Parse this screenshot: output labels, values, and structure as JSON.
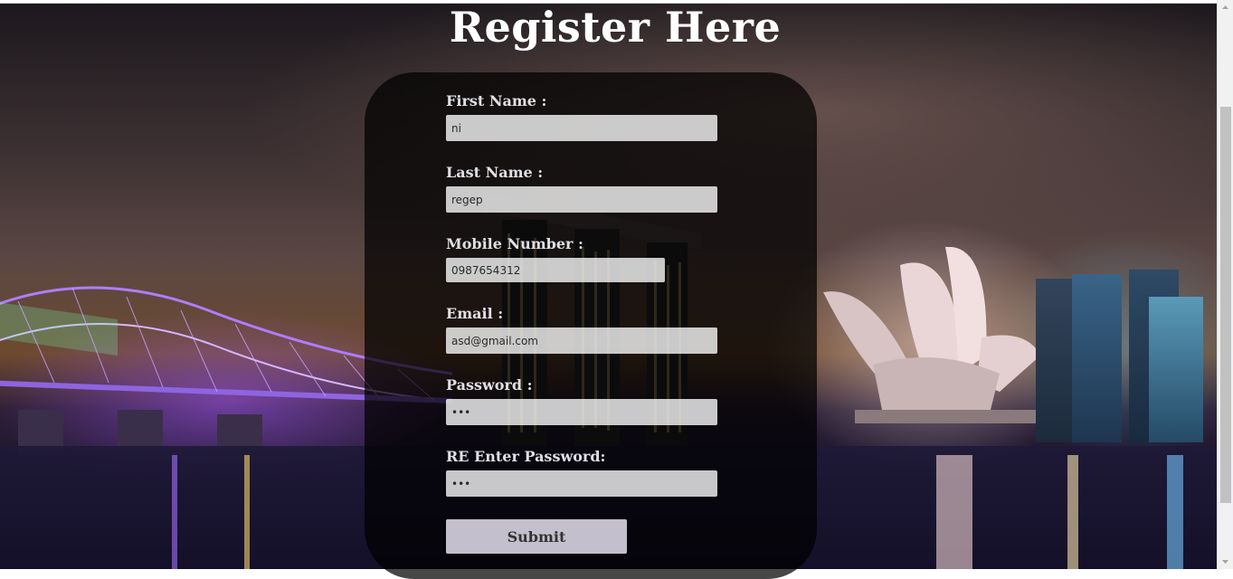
{
  "page": {
    "title": "Register Here"
  },
  "form": {
    "first_name": {
      "label": "First Name :",
      "value": "ni"
    },
    "last_name": {
      "label": "Last Name :",
      "value": "regep"
    },
    "mobile": {
      "label": "Mobile Number :",
      "value": "0987654312"
    },
    "email": {
      "label": "Email :",
      "value": "asd@gmail.com"
    },
    "password": {
      "label": "Password :",
      "value": "•••"
    },
    "re_password": {
      "label": "RE Enter Password:",
      "value": "•••"
    },
    "submit_label": "Submit"
  },
  "colors": {
    "title": "#ffffff",
    "panel": "rgba(0,0,0,0.72)",
    "label": "#e0dfe3"
  }
}
